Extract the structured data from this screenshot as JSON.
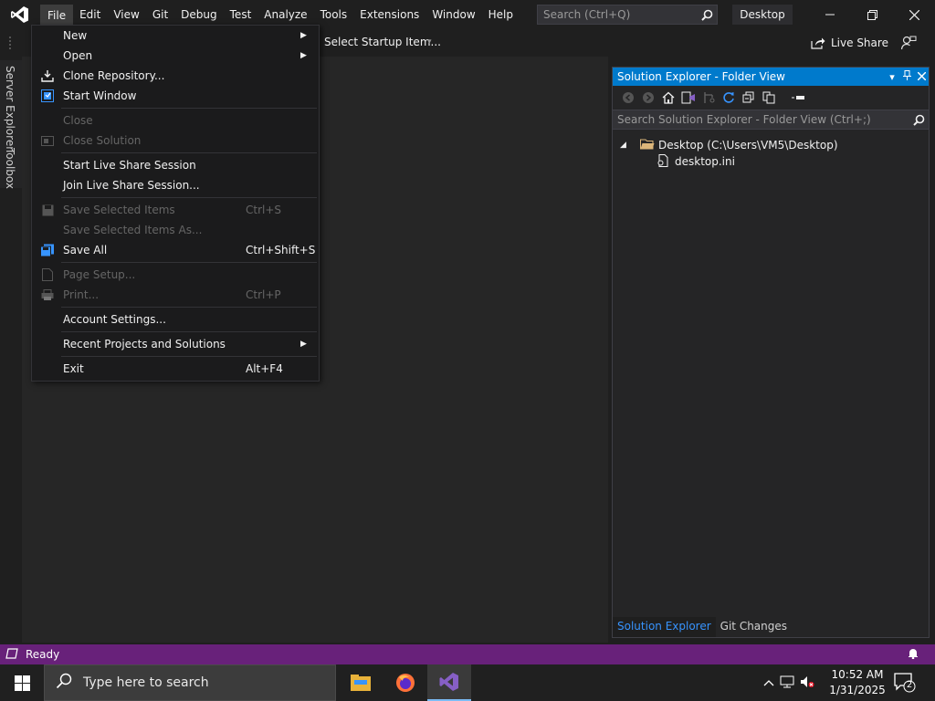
{
  "menubar": [
    "File",
    "Edit",
    "View",
    "Git",
    "Debug",
    "Test",
    "Analyze",
    "Tools",
    "Extensions",
    "Window",
    "Help"
  ],
  "search": {
    "placeholder": "Search (Ctrl+Q)"
  },
  "window_title": "Desktop",
  "toolbar": {
    "startup": "Select Startup Item...",
    "liveshare": "Live Share"
  },
  "side_tabs": {
    "server_explorer": "Server Explorer",
    "toolbox": "Toolbox"
  },
  "file_menu": {
    "new": "New",
    "open": "Open",
    "clone": "Clone Repository...",
    "start_window": "Start Window",
    "close": "Close",
    "close_solution": "Close Solution",
    "start_live_share": "Start Live Share Session",
    "join_live_share": "Join Live Share Session...",
    "save_selected": "Save Selected Items",
    "save_selected_sc": "Ctrl+S",
    "save_selected_as": "Save Selected Items As...",
    "save_all": "Save All",
    "save_all_sc": "Ctrl+Shift+S",
    "page_setup": "Page Setup...",
    "print": "Print...",
    "print_sc": "Ctrl+P",
    "account_settings": "Account Settings...",
    "recent": "Recent Projects and Solutions",
    "exit": "Exit",
    "exit_sc": "Alt+F4"
  },
  "solution_explorer": {
    "title": "Solution Explorer - Folder View",
    "search_placeholder": "Search Solution Explorer - Folder View (Ctrl+;)",
    "root": "Desktop (C:\\Users\\VM5\\Desktop)",
    "file": "desktop.ini",
    "tab_solution": "Solution Explorer",
    "tab_git": "Git Changes"
  },
  "status": {
    "text": "Ready"
  },
  "taskbar": {
    "search_placeholder": "Type here to search",
    "time": "10:52 AM",
    "date": "1/31/2025",
    "notification_count": "2"
  },
  "colors": {
    "accent": "#007acc",
    "status_bar": "#68217a",
    "vs_purple": "#865fc5"
  }
}
